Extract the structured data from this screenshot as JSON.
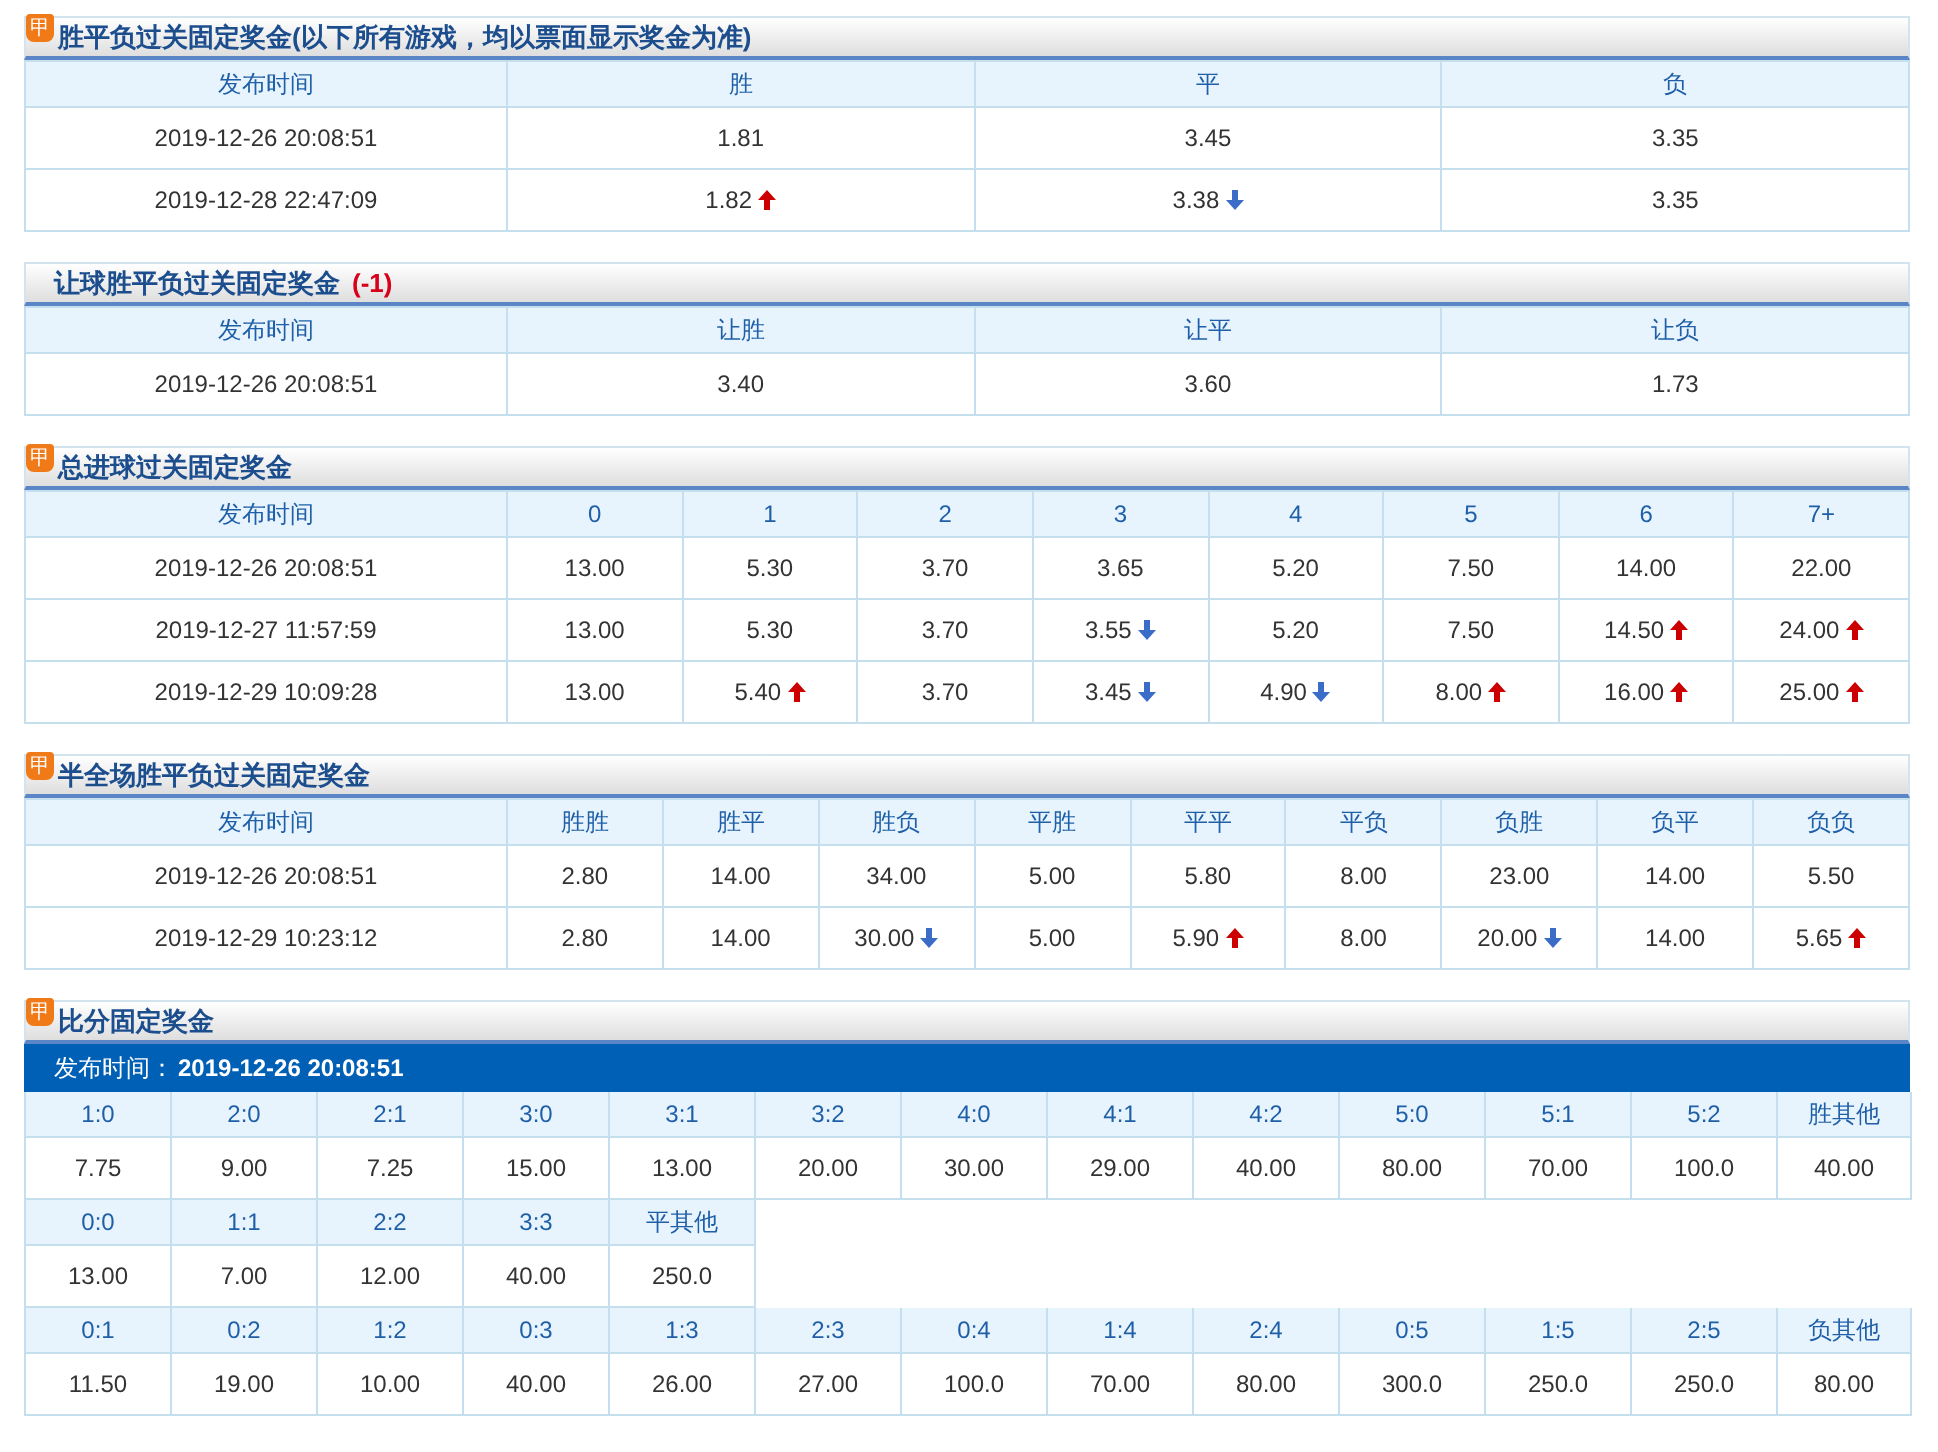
{
  "sections": [
    {
      "badge": "甲",
      "title": "胜平负过关固定奖金(以下所有游戏，均以票面显示奖金为准)",
      "columns": [
        "发布时间",
        "胜",
        "平",
        "负"
      ],
      "rows": [
        [
          {
            "value": "2019-12-26 20:08:51",
            "up": false,
            "down": false
          },
          {
            "value": "1.81",
            "up": false,
            "down": false
          },
          {
            "value": "3.45",
            "up": false,
            "down": false
          },
          {
            "value": "3.35",
            "up": false,
            "down": false
          }
        ],
        [
          {
            "value": "2019-12-28 22:47:09",
            "up": false,
            "down": false
          },
          {
            "value": "1.82",
            "up": true,
            "down": false
          },
          {
            "value": "3.38",
            "up": false,
            "down": true
          },
          {
            "value": "3.35",
            "up": false,
            "down": false
          }
        ]
      ]
    },
    {
      "title": "让球胜平负过关固定奖金",
      "note": "(-1)",
      "columns": [
        "发布时间",
        "让胜",
        "让平",
        "让负"
      ],
      "rows": [
        [
          {
            "value": "2019-12-26 20:08:51",
            "up": false,
            "down": false
          },
          {
            "value": "3.40",
            "up": false,
            "down": false
          },
          {
            "value": "3.60",
            "up": false,
            "down": false
          },
          {
            "value": "1.73",
            "up": false,
            "down": false
          }
        ]
      ]
    },
    {
      "badge": "甲",
      "title": "总进球过关固定奖金",
      "columns": [
        "发布时间",
        "0",
        "1",
        "2",
        "3",
        "4",
        "5",
        "6",
        "7+"
      ],
      "rows": [
        [
          {
            "value": "2019-12-26 20:08:51",
            "up": false,
            "down": false
          },
          {
            "value": "13.00",
            "up": false,
            "down": false
          },
          {
            "value": "5.30",
            "up": false,
            "down": false
          },
          {
            "value": "3.70",
            "up": false,
            "down": false
          },
          {
            "value": "3.65",
            "up": false,
            "down": false
          },
          {
            "value": "5.20",
            "up": false,
            "down": false
          },
          {
            "value": "7.50",
            "up": false,
            "down": false
          },
          {
            "value": "14.00",
            "up": false,
            "down": false
          },
          {
            "value": "22.00",
            "up": false,
            "down": false
          }
        ],
        [
          {
            "value": "2019-12-27 11:57:59",
            "up": false,
            "down": false
          },
          {
            "value": "13.00",
            "up": false,
            "down": false
          },
          {
            "value": "5.30",
            "up": false,
            "down": false
          },
          {
            "value": "3.70",
            "up": false,
            "down": false
          },
          {
            "value": "3.55",
            "up": false,
            "down": true
          },
          {
            "value": "5.20",
            "up": false,
            "down": false
          },
          {
            "value": "7.50",
            "up": false,
            "down": false
          },
          {
            "value": "14.50",
            "up": true,
            "down": false
          },
          {
            "value": "24.00",
            "up": true,
            "down": false
          }
        ],
        [
          {
            "value": "2019-12-29 10:09:28",
            "up": false,
            "down": false
          },
          {
            "value": "13.00",
            "up": false,
            "down": false
          },
          {
            "value": "5.40",
            "up": true,
            "down": false
          },
          {
            "value": "3.70",
            "up": false,
            "down": false
          },
          {
            "value": "3.45",
            "up": false,
            "down": true
          },
          {
            "value": "4.90",
            "up": false,
            "down": true
          },
          {
            "value": "8.00",
            "up": true,
            "down": false
          },
          {
            "value": "16.00",
            "up": true,
            "down": false
          },
          {
            "value": "25.00",
            "up": true,
            "down": false
          }
        ]
      ]
    },
    {
      "badge": "甲",
      "title": "半全场胜平负过关固定奖金",
      "columns": [
        "发布时间",
        "胜胜",
        "胜平",
        "胜负",
        "平胜",
        "平平",
        "平负",
        "负胜",
        "负平",
        "负负"
      ],
      "rows": [
        [
          {
            "value": "2019-12-26 20:08:51",
            "up": false,
            "down": false
          },
          {
            "value": "2.80",
            "up": false,
            "down": false
          },
          {
            "value": "14.00",
            "up": false,
            "down": false
          },
          {
            "value": "34.00",
            "up": false,
            "down": false
          },
          {
            "value": "5.00",
            "up": false,
            "down": false
          },
          {
            "value": "5.80",
            "up": false,
            "down": false
          },
          {
            "value": "8.00",
            "up": false,
            "down": false
          },
          {
            "value": "23.00",
            "up": false,
            "down": false
          },
          {
            "value": "14.00",
            "up": false,
            "down": false
          },
          {
            "value": "5.50",
            "up": false,
            "down": false
          }
        ],
        [
          {
            "value": "2019-12-29 10:23:12",
            "up": false,
            "down": false
          },
          {
            "value": "2.80",
            "up": false,
            "down": false
          },
          {
            "value": "14.00",
            "up": false,
            "down": false
          },
          {
            "value": "30.00",
            "up": false,
            "down": true
          },
          {
            "value": "5.00",
            "up": false,
            "down": false
          },
          {
            "value": "5.90",
            "up": true,
            "down": false
          },
          {
            "value": "8.00",
            "up": false,
            "down": false
          },
          {
            "value": "20.00",
            "up": false,
            "down": true
          },
          {
            "value": "14.00",
            "up": false,
            "down": false
          },
          {
            "value": "5.65",
            "up": true,
            "down": false
          }
        ]
      ]
    }
  ],
  "score": {
    "badge": "甲",
    "title": "比分固定奖金",
    "time_label": "发布时间：",
    "time": "2019-12-26 20:08:51",
    "groups": [
      [
        {
          "score": "1:0",
          "odds": "7.75"
        },
        {
          "score": "2:0",
          "odds": "9.00"
        },
        {
          "score": "2:1",
          "odds": "7.25"
        },
        {
          "score": "3:0",
          "odds": "15.00"
        },
        {
          "score": "3:1",
          "odds": "13.00"
        },
        {
          "score": "3:2",
          "odds": "20.00"
        },
        {
          "score": "4:0",
          "odds": "30.00"
        },
        {
          "score": "4:1",
          "odds": "29.00"
        },
        {
          "score": "4:2",
          "odds": "40.00"
        },
        {
          "score": "5:0",
          "odds": "80.00"
        },
        {
          "score": "5:1",
          "odds": "70.00"
        },
        {
          "score": "5:2",
          "odds": "100.0"
        },
        {
          "score": "胜其他",
          "odds": "40.00"
        }
      ],
      [
        {
          "score": "0:0",
          "odds": "13.00"
        },
        {
          "score": "1:1",
          "odds": "7.00"
        },
        {
          "score": "2:2",
          "odds": "12.00"
        },
        {
          "score": "3:3",
          "odds": "40.00"
        },
        {
          "score": "平其他",
          "odds": "250.0"
        }
      ],
      [
        {
          "score": "0:1",
          "odds": "11.50"
        },
        {
          "score": "0:2",
          "odds": "19.00"
        },
        {
          "score": "1:2",
          "odds": "10.00"
        },
        {
          "score": "0:3",
          "odds": "40.00"
        },
        {
          "score": "1:3",
          "odds": "26.00"
        },
        {
          "score": "2:3",
          "odds": "27.00"
        },
        {
          "score": "0:4",
          "odds": "100.0"
        },
        {
          "score": "1:4",
          "odds": "70.00"
        },
        {
          "score": "2:4",
          "odds": "80.00"
        },
        {
          "score": "0:5",
          "odds": "300.0"
        },
        {
          "score": "1:5",
          "odds": "250.0"
        },
        {
          "score": "2:5",
          "odds": "250.0"
        },
        {
          "score": "负其他",
          "odds": "80.00"
        }
      ]
    ]
  }
}
